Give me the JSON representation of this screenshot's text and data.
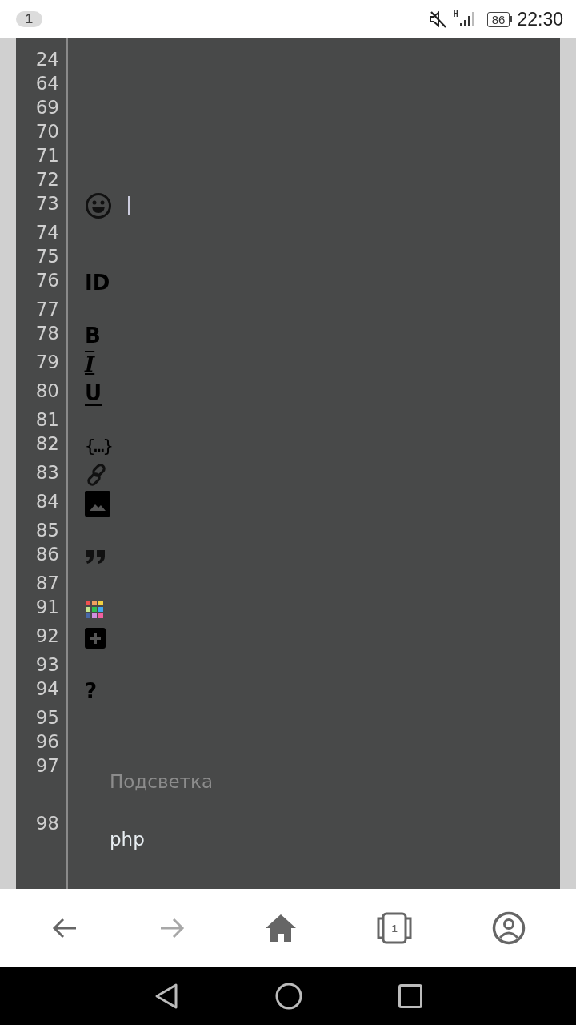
{
  "status_bar": {
    "notification_count": "1",
    "muted": true,
    "network_type": "H",
    "battery": "86",
    "time": "22:30"
  },
  "editor": {
    "lines": [
      {
        "number": "24",
        "kind": "empty"
      },
      {
        "number": "64",
        "kind": "empty"
      },
      {
        "number": "69",
        "kind": "empty"
      },
      {
        "number": "70",
        "kind": "empty"
      },
      {
        "number": "71",
        "kind": "empty"
      },
      {
        "number": "72",
        "kind": "empty"
      },
      {
        "number": "73",
        "kind": "emoji",
        "cursor": true
      },
      {
        "number": "74",
        "kind": "empty"
      },
      {
        "number": "75",
        "kind": "empty"
      },
      {
        "number": "76",
        "kind": "id",
        "text": "ID"
      },
      {
        "number": "77",
        "kind": "empty"
      },
      {
        "number": "78",
        "kind": "bold",
        "text": "B"
      },
      {
        "number": "79",
        "kind": "italic",
        "text": "I"
      },
      {
        "number": "80",
        "kind": "underline",
        "text": "U"
      },
      {
        "number": "81",
        "kind": "empty"
      },
      {
        "number": "82",
        "kind": "code",
        "text": "{…}"
      },
      {
        "number": "83",
        "kind": "link"
      },
      {
        "number": "84",
        "kind": "image"
      },
      {
        "number": "85",
        "kind": "empty"
      },
      {
        "number": "86",
        "kind": "quote"
      },
      {
        "number": "87",
        "kind": "empty"
      },
      {
        "number": "91",
        "kind": "palette"
      },
      {
        "number": "92",
        "kind": "add"
      },
      {
        "number": "93",
        "kind": "empty"
      },
      {
        "number": "94",
        "kind": "help",
        "text": "?"
      },
      {
        "number": "95",
        "kind": "empty"
      },
      {
        "number": "96",
        "kind": "empty"
      },
      {
        "number": "97",
        "kind": "menu-label",
        "text": "Подсветка"
      },
      {
        "number": "98",
        "kind": "menu-item",
        "text": "php"
      }
    ]
  },
  "browser_bar": {
    "back": {
      "disabled": false
    },
    "forward": {
      "disabled": true
    },
    "tab_count": "1"
  }
}
